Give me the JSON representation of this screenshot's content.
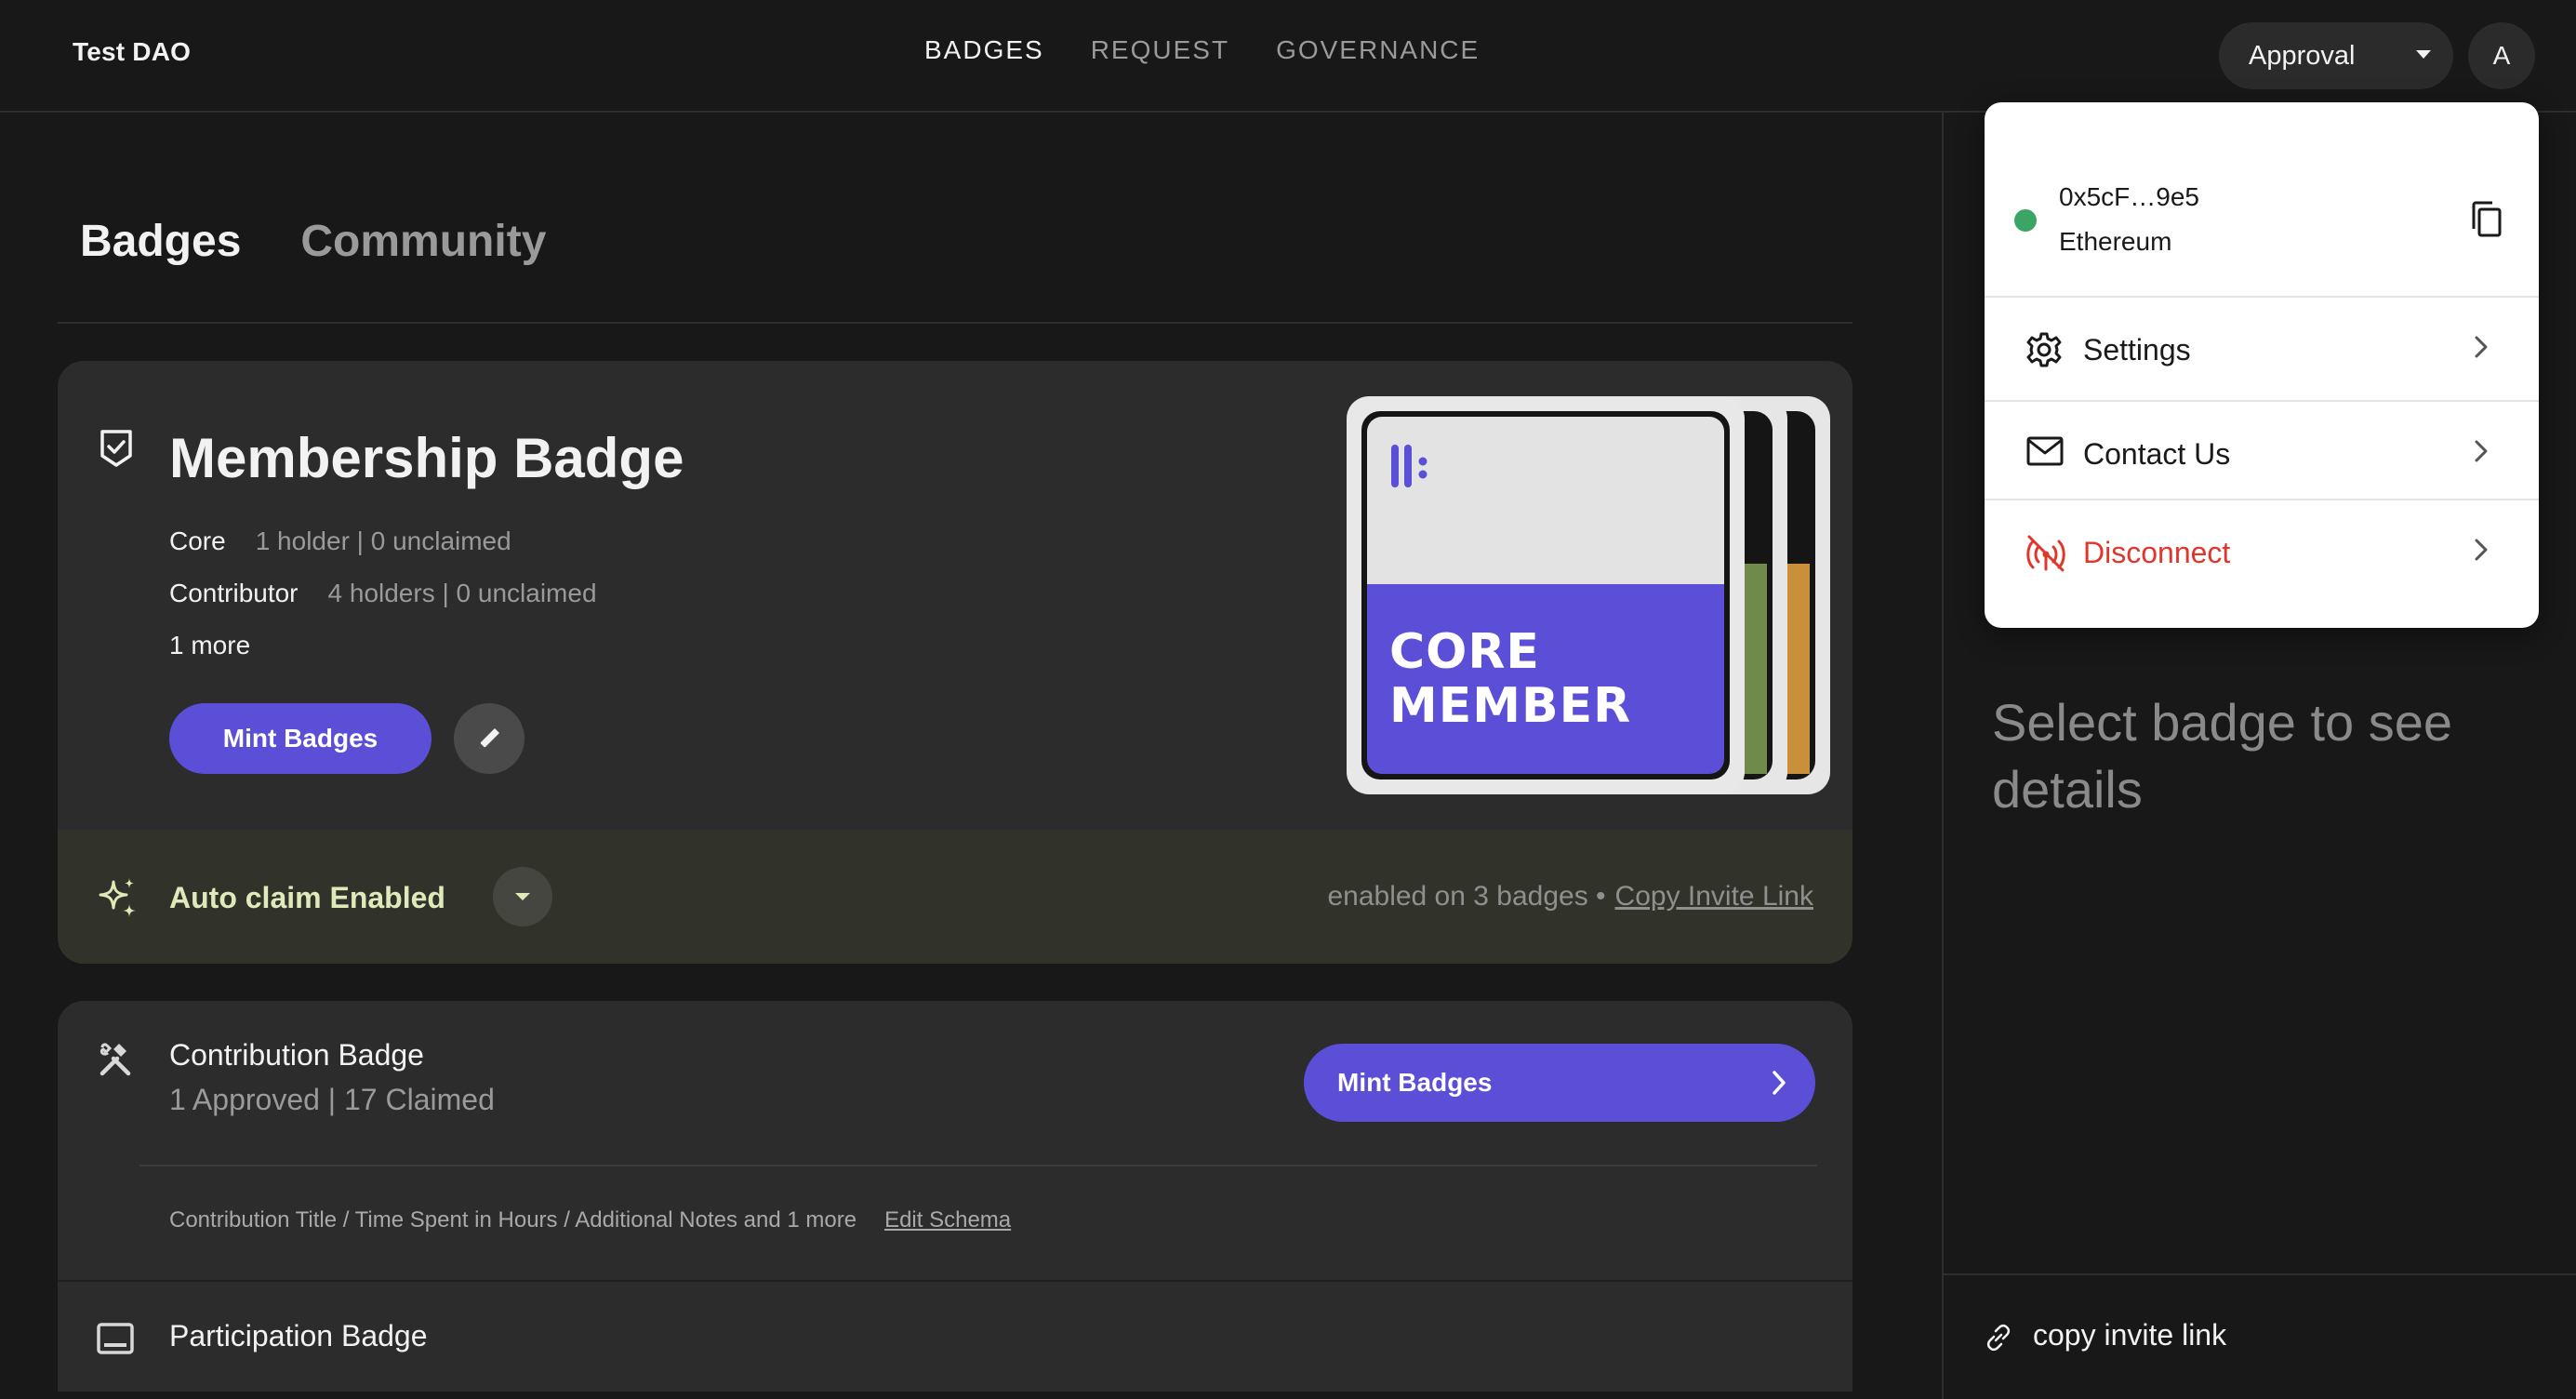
{
  "header": {
    "brand": "Test DAO",
    "nav": [
      {
        "label": "BADGES",
        "active": true
      },
      {
        "label": "REQUEST",
        "active": false
      },
      {
        "label": "GOVERNANCE",
        "active": false
      }
    ],
    "role_select": "Approval",
    "avatar_initial": "A"
  },
  "page_tabs": [
    {
      "label": "Badges",
      "active": true
    },
    {
      "label": "Community",
      "active": false
    }
  ],
  "membership": {
    "title": "Membership Badge",
    "tiers": [
      {
        "name": "Core",
        "meta": "1 holder | 0 unclaimed"
      },
      {
        "name": "Contributor",
        "meta": "4 holders | 0 unclaimed"
      }
    ],
    "more": "1 more",
    "mint_label": "Mint Badges",
    "badge_art_text": "CORE MEMBER",
    "auto_claim": {
      "title": "Auto claim Enabled",
      "status": "enabled on 3 badges •",
      "link": "Copy Invite Link"
    }
  },
  "contribution": {
    "title": "Contribution Badge",
    "subtitle": "1 Approved | 17 Claimed",
    "mint_label": "Mint Badges",
    "schema": "Contribution Title / Time Spent in Hours / Additional Notes and 1 more",
    "schema_link": "Edit Schema"
  },
  "participation": {
    "title": "Participation Badge"
  },
  "right_panel": {
    "placeholder": "Select badge to see details",
    "footer_link": "copy invite link"
  },
  "account_menu": {
    "address": "0x5cF…9e5",
    "network": "Ethereum",
    "items": [
      {
        "label": "Settings",
        "icon": "gear-icon"
      },
      {
        "label": "Contact Us",
        "icon": "mail-icon"
      },
      {
        "label": "Disconnect",
        "icon": "broadcast-off-icon"
      }
    ]
  },
  "colors": {
    "accent": "#5b4fd8",
    "background": "#181818",
    "card": "#2c2c2c",
    "auto_claim_bg": "#31332a",
    "auto_claim_text": "#dfe9b9",
    "online_dot": "#3aa564",
    "danger": "#e0362c"
  }
}
